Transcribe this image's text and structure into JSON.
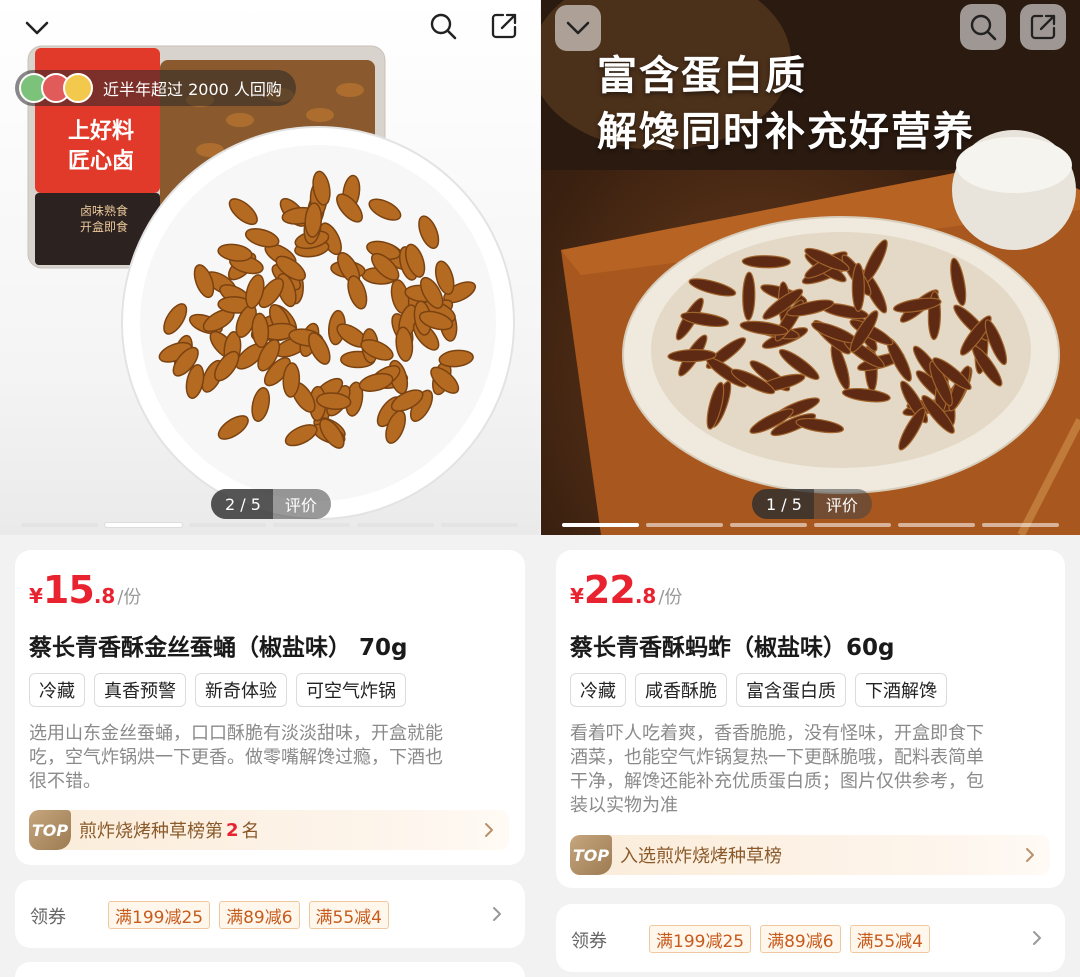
{
  "left": {
    "repurchase_badge": "近半年超过 2000 人回购",
    "package_label_1": "上好料",
    "package_label_2": "匠心卤",
    "package_sub_1": "卤味熟食",
    "package_sub_2": "开盒即食",
    "image_counter": "2 / 5",
    "review_label": "评价",
    "images_total": 5,
    "image_current": 2,
    "price_currency": "¥",
    "price_int": "15",
    "price_dec": ".8",
    "price_unit": "/份",
    "title": "蔡长青香酥金丝蚕蛹（椒盐味） 70g",
    "tags": [
      "冷藏",
      "真香预警",
      "新奇体验",
      "可空气炸锅"
    ],
    "desc_lines": [
      "选用山东金丝蚕蛹，口口酥脆有淡淡甜味，开盒就能",
      "吃，空气炸锅烘一下更香。做零嘴解馋过瘾，下酒也",
      "很不错。"
    ],
    "rank_top": "TOP",
    "rank_prefix": "煎炸烧烤种草榜第",
    "rank_number": "2",
    "rank_suffix": "名",
    "coupon_label": "领券",
    "coupons": [
      "满199减25",
      "满89减6",
      "满55减4"
    ]
  },
  "right": {
    "headline_1": "富含蛋白质",
    "headline_2": "解馋同时补充好营养",
    "image_counter": "1 / 5",
    "review_label": "评价",
    "images_total": 5,
    "image_current": 1,
    "price_currency": "¥",
    "price_int": "22",
    "price_dec": ".8",
    "price_unit": "/份",
    "title": "蔡长青香酥蚂蚱（椒盐味）60g",
    "tags": [
      "冷藏",
      "咸香酥脆",
      "富含蛋白质",
      "下酒解馋"
    ],
    "desc_lines": [
      "看着吓人吃着爽，香香脆脆，没有怪味，开盒即食下",
      "酒菜，也能空气炸锅复热一下更酥脆哦，配料表简单",
      "干净，解馋还能补充优质蛋白质；图片仅供参考，包",
      "装以实物为准"
    ],
    "rank_top": "TOP",
    "rank_text": "入选煎炸烧烤种草榜",
    "coupon_label": "领券",
    "coupons": [
      "满199减25",
      "满89减6",
      "满55减4"
    ]
  },
  "colors": {
    "price_red": "#e8232f",
    "rank_gold": "#8a5a2b",
    "coupon_orange": "#c75b1c",
    "package_red": "#e23a2a"
  }
}
